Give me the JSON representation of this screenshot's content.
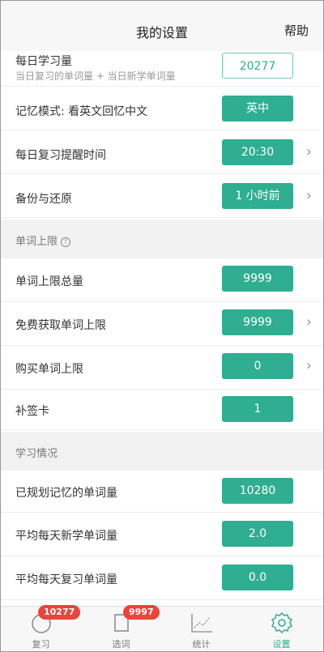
{
  "header": {
    "title": "我的设置",
    "help": "帮助"
  },
  "rows": [
    {
      "label": "每日学习量",
      "sub": "当日复习的单词量 + 当日新学单词量",
      "value": "20277"
    },
    {
      "label": "记忆模式: 看英文回忆中文",
      "value": "英中"
    },
    {
      "label": "每日复习提醒时间",
      "value": "20:30"
    },
    {
      "label": "备份与还原",
      "value": "1 小时前"
    }
  ],
  "section1": {
    "label": "单词上限",
    "icon": "info-icon"
  },
  "limits": [
    {
      "label": "单词上限总量",
      "value": "9999"
    },
    {
      "label": "免费获取单词上限",
      "value": "9999"
    },
    {
      "label": "购买单词上限",
      "value": "0"
    },
    {
      "label": "补签卡",
      "value": "1"
    }
  ],
  "section2": {
    "label": "学习情况"
  },
  "stats": [
    {
      "label": "已规划记忆的单词量",
      "value": "10280"
    },
    {
      "label": "平均每天新学单词量",
      "value": "2.0"
    },
    {
      "label": "平均每天复习单词量",
      "value": "0.0"
    }
  ],
  "tabs": [
    {
      "label": "复习",
      "icon": "review-icon",
      "badge": "10277"
    },
    {
      "label": "选词",
      "icon": "select-words-icon",
      "badge": "9997"
    },
    {
      "label": "统计",
      "icon": "chart-icon"
    },
    {
      "label": "设置",
      "icon": "gear-icon",
      "active": true
    }
  ],
  "colors": {
    "accent": "#2fae91",
    "badge": "#e8453c"
  }
}
